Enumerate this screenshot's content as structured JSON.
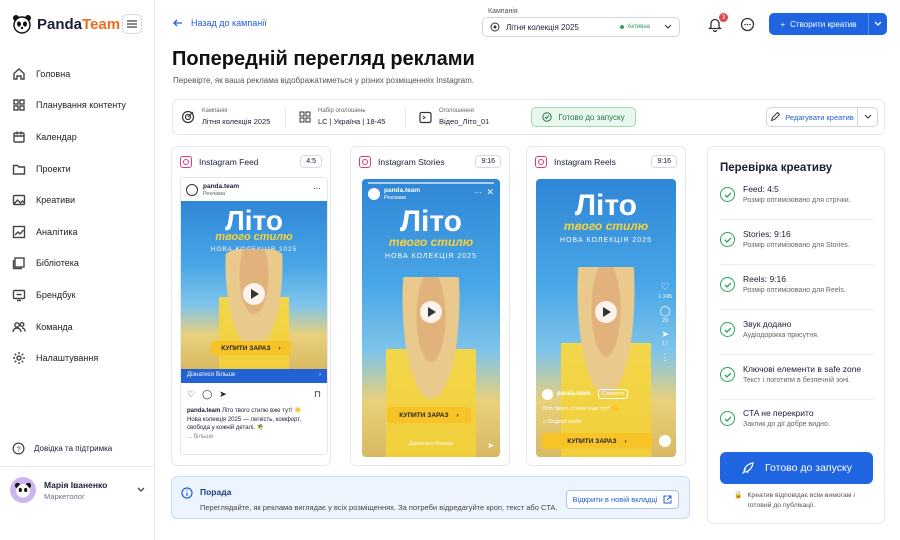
{
  "app": {
    "name_part1": "Panda",
    "name_part2": "Team"
  },
  "sidebar": {
    "items": [
      {
        "label": "Головна",
        "icon": "home-icon"
      },
      {
        "label": "Планування контенту",
        "icon": "grid-icon"
      },
      {
        "label": "Календар",
        "icon": "calendar-icon"
      },
      {
        "label": "Проекти",
        "icon": "folder-icon"
      },
      {
        "label": "Креативи",
        "icon": "image-icon"
      },
      {
        "label": "Аналітика",
        "icon": "chart-icon"
      },
      {
        "label": "Бібліотека",
        "icon": "library-icon"
      },
      {
        "label": "Брендбук",
        "icon": "book-icon"
      },
      {
        "label": "Команда",
        "icon": "team-icon"
      },
      {
        "label": "Налаштування",
        "icon": "gear-icon"
      }
    ],
    "help": "Довідка та підтримка"
  },
  "user": {
    "name": "Марія Іваненко",
    "role": "Маркетолог"
  },
  "topbar": {
    "back": "Назад до кампанії",
    "campaign_label": "Кампанія",
    "campaign_value": "Літня колекція 2025",
    "campaign_status": "Активна",
    "notifications": "3",
    "create": "Створити креатив"
  },
  "page": {
    "title": "Попередній перегляд реклами",
    "subtitle": "Перевірте, як ваша реклама відображатиметься у різних розміщеннях Instagram."
  },
  "info": {
    "campaign_k": "Кампанія",
    "campaign_v": "Літня колекція 2025",
    "set_k": "Набір оголошень",
    "set_v": "LC | Україна | 18-45",
    "ad_k": "Оголошення",
    "ad_v": "Відео_Літо_01",
    "ready": "Готово до запуску",
    "edit": "Редагувати креатив"
  },
  "creative": {
    "title1": "Літо",
    "title2": "твого стилю",
    "subtitle": "НОВА КОЛЕКЦІЯ 2025",
    "cta": "КУПИТИ ЗАРАЗ"
  },
  "feed": {
    "name": "Instagram Feed",
    "ratio": "4:5",
    "account": "panda.team",
    "sponsored": "Реклама",
    "learn": "Дізнатися більше",
    "caption_user": "panda.team",
    "caption": "Літо твого стилю вже тут! ☀️",
    "caption2": "Нова колекція 2025 — легкість, комфорт,",
    "caption3": "свобода у кожній деталі. 🌴",
    "more": "... більше"
  },
  "stories": {
    "name": "Instagram Stories",
    "ratio": "9:16",
    "account": "panda.team",
    "sponsored": "Реклама",
    "swipe": "Дізнатися більше"
  },
  "reels": {
    "name": "Instagram Reels",
    "ratio": "9:16",
    "likes": "1 245",
    "comments": "23",
    "shares": "17",
    "account": "panda.team",
    "follow": "Стежити",
    "caption": "Літо твого стилю вже тут! ☀️",
    "audio": "Original audio"
  },
  "checks": {
    "title": "Перевірка креативу",
    "items": [
      {
        "t": "Feed: 4:5",
        "d": "Розмір оптимізовано для стрічки."
      },
      {
        "t": "Stories: 9:16",
        "d": "Розмір оптимізовано для Stories."
      },
      {
        "t": "Reels: 9:16",
        "d": "Розмір оптимізовано для Reels."
      },
      {
        "t": "Звук додано",
        "d": "Аудіодоріжка присутня."
      },
      {
        "t": "Ключові елементи в safe zone",
        "d": "Текст і логотипи в безпечній зоні."
      },
      {
        "t": "CTA не перекрито",
        "d": "Заклик до дії добре видно."
      }
    ],
    "ready_btn": "Готово до запуску",
    "note": "Креатив відповідає всім вимогам і готовий до публікації."
  },
  "tip": {
    "title": "Порада",
    "text": "Переглядайте, як реклама виглядає у всіх розміщеннях. За потреби відредагуйте кроп, текст або CTA.",
    "button": "Відкрити в новій вкладці"
  },
  "colors": {
    "accent": "#1f64e0",
    "brand_orange": "#f26b1d",
    "success": "#2aa55d",
    "cta_yellow": "#f7c326"
  }
}
